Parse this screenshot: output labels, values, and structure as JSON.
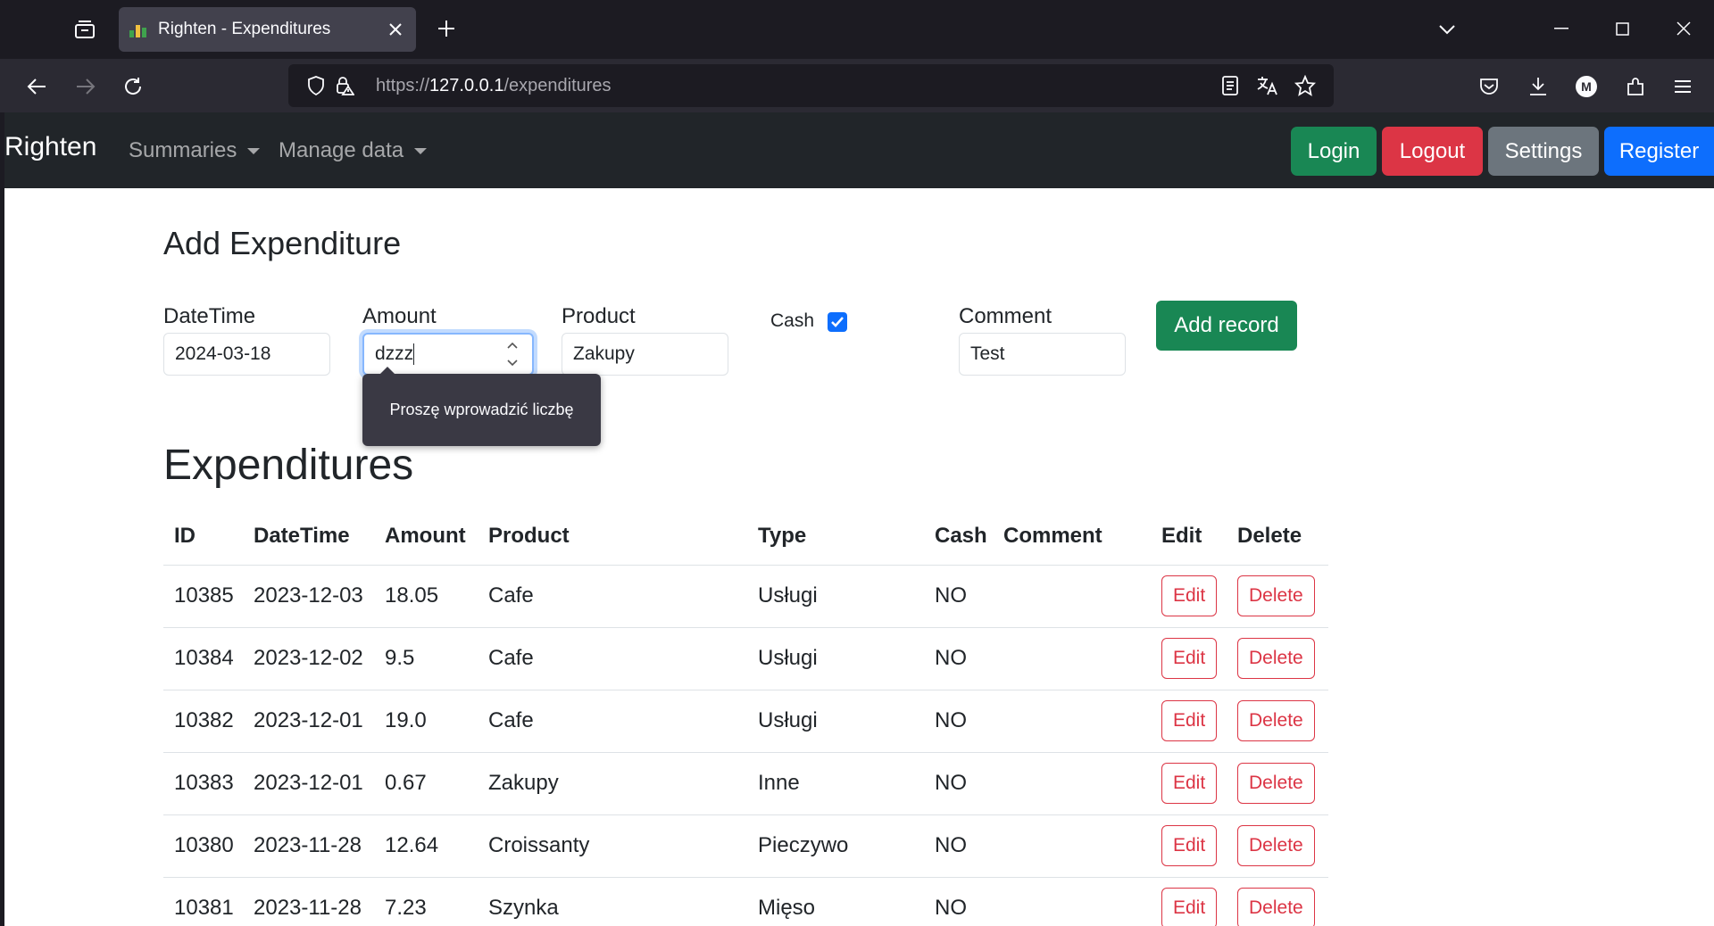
{
  "browser": {
    "tab_title": "Righten - Expenditures",
    "url_scheme": "https://",
    "url_host": "127.0.0.1",
    "url_path": "/expenditures",
    "profile_initial": "M"
  },
  "site": {
    "brand": "Righten",
    "menus": [
      "Summaries",
      "Manage data"
    ],
    "buttons": {
      "login": "Login",
      "logout": "Logout",
      "settings": "Settings",
      "register": "Register"
    }
  },
  "form": {
    "heading": "Add Expenditure",
    "datetime_label": "DateTime",
    "datetime_value": "2024-03-18",
    "amount_label": "Amount",
    "amount_value": "dzzz",
    "product_label": "Product",
    "product_value": "Zakupy",
    "cash_label": "Cash",
    "cash_checked": true,
    "comment_label": "Comment",
    "comment_value": "Test",
    "submit_label": "Add record",
    "validation_tooltip": "Proszę wprowadzić liczbę"
  },
  "list": {
    "heading": "Expenditures",
    "columns": [
      "ID",
      "DateTime",
      "Amount",
      "Product",
      "Type",
      "Cash",
      "Comment",
      "Edit",
      "Delete"
    ],
    "edit_label": "Edit",
    "delete_label": "Delete",
    "rows": [
      {
        "id": "10385",
        "datetime": "2023-12-03",
        "amount": "18.05",
        "product": "Cafe",
        "type": "Usługi",
        "cash": "NO",
        "comment": ""
      },
      {
        "id": "10384",
        "datetime": "2023-12-02",
        "amount": "9.5",
        "product": "Cafe",
        "type": "Usługi",
        "cash": "NO",
        "comment": ""
      },
      {
        "id": "10382",
        "datetime": "2023-12-01",
        "amount": "19.0",
        "product": "Cafe",
        "type": "Usługi",
        "cash": "NO",
        "comment": ""
      },
      {
        "id": "10383",
        "datetime": "2023-12-01",
        "amount": "0.67",
        "product": "Zakupy",
        "type": "Inne",
        "cash": "NO",
        "comment": ""
      },
      {
        "id": "10380",
        "datetime": "2023-11-28",
        "amount": "12.64",
        "product": "Croissanty",
        "type": "Pieczywo",
        "cash": "NO",
        "comment": ""
      },
      {
        "id": "10381",
        "datetime": "2023-11-28",
        "amount": "7.23",
        "product": "Szynka",
        "type": "Mięso",
        "cash": "NO",
        "comment": ""
      }
    ]
  },
  "colors": {
    "navbar": "#212529",
    "success": "#198754",
    "danger": "#dc3545",
    "secondary": "#6c757d",
    "primary": "#0d6efd"
  }
}
